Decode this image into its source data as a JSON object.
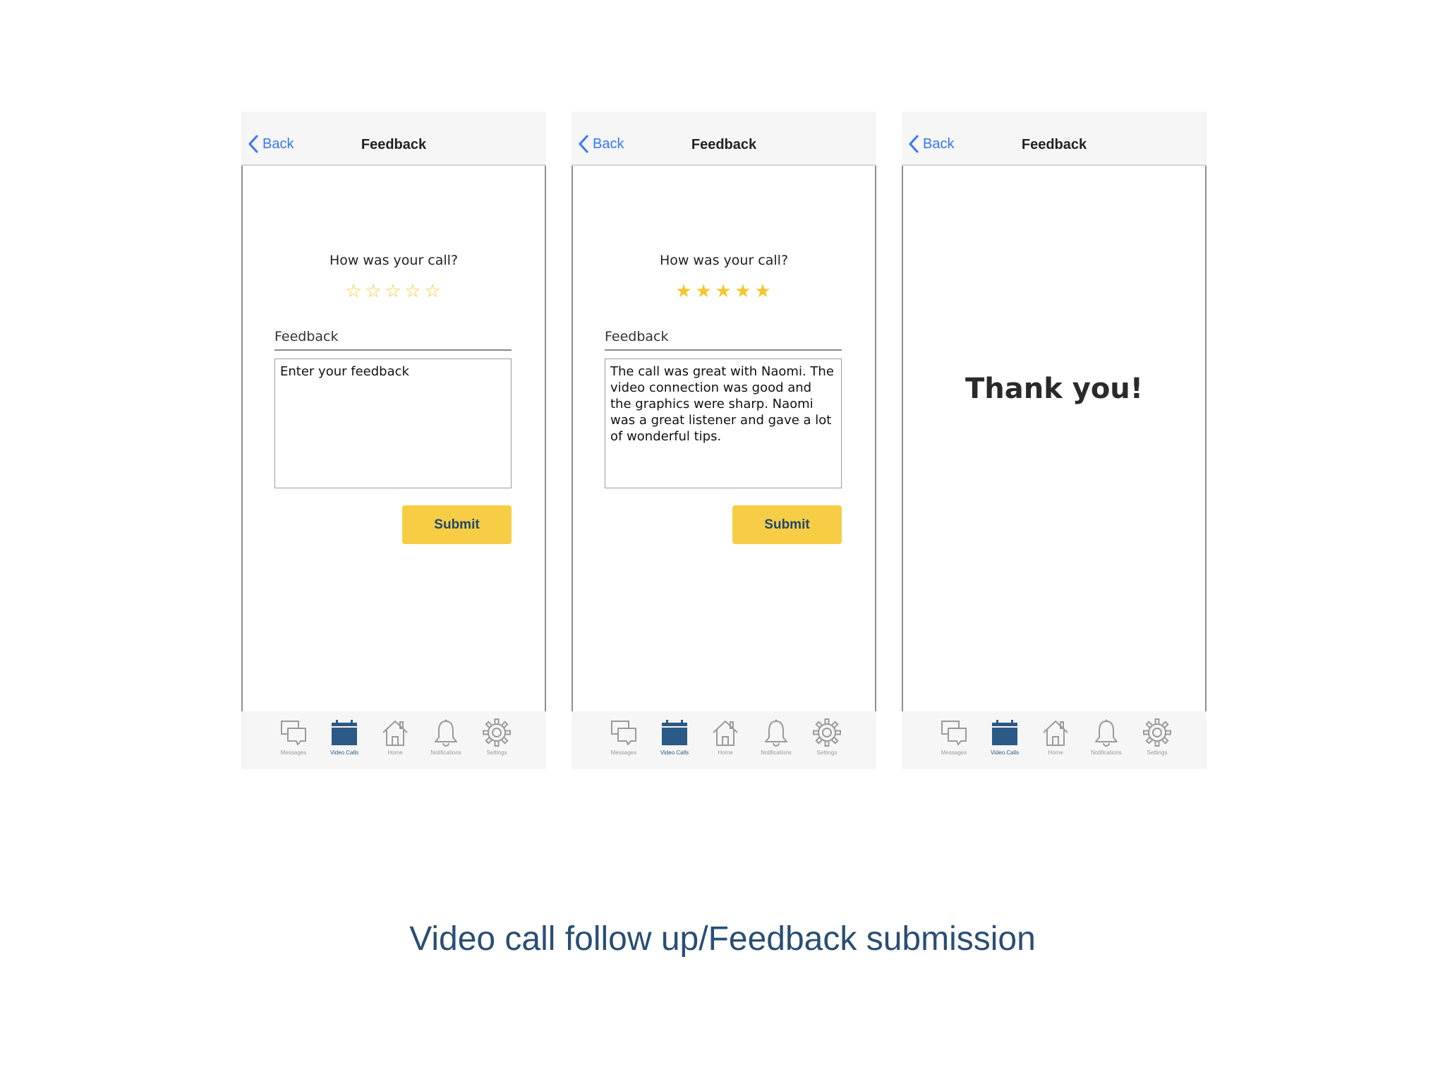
{
  "screens": [
    {
      "nav": {
        "back_label": "Back",
        "title": "Feedback"
      },
      "question": "How was your call?",
      "rating": 0,
      "feedback_label": "Feedback",
      "feedback_text": "",
      "feedback_placeholder": "Enter your feedback",
      "submit_label": "Submit"
    },
    {
      "nav": {
        "back_label": "Back",
        "title": "Feedback"
      },
      "question": "How was your call?",
      "rating": 5,
      "feedback_label": "Feedback",
      "feedback_text": "The call was great with Naomi. The video connection was good and the graphics were sharp. Naomi was a great listener and gave a lot of wonderful tips.",
      "submit_label": "Submit"
    },
    {
      "nav": {
        "back_label": "Back",
        "title": "Feedback"
      },
      "message": "Thank you!"
    }
  ],
  "tabbar": {
    "active": "Video Calls",
    "tabs": [
      {
        "label": "Messages",
        "icon": "messages-icon"
      },
      {
        "label": "Video Calls",
        "icon": "calendar-icon"
      },
      {
        "label": "Home",
        "icon": "home-icon"
      },
      {
        "label": "Notifications",
        "icon": "bell-icon"
      },
      {
        "label": "Settings",
        "icon": "gear-icon"
      }
    ]
  },
  "colors": {
    "accent_blue": "#3478f6",
    "star_yellow": "#f5c62e",
    "submit_bg": "#f6cd45",
    "submit_text": "#24486c",
    "active_tab": "#2a5a85",
    "inactive_tab": "#9a9a9a"
  },
  "caption": "Video call follow up/Feedback submission"
}
